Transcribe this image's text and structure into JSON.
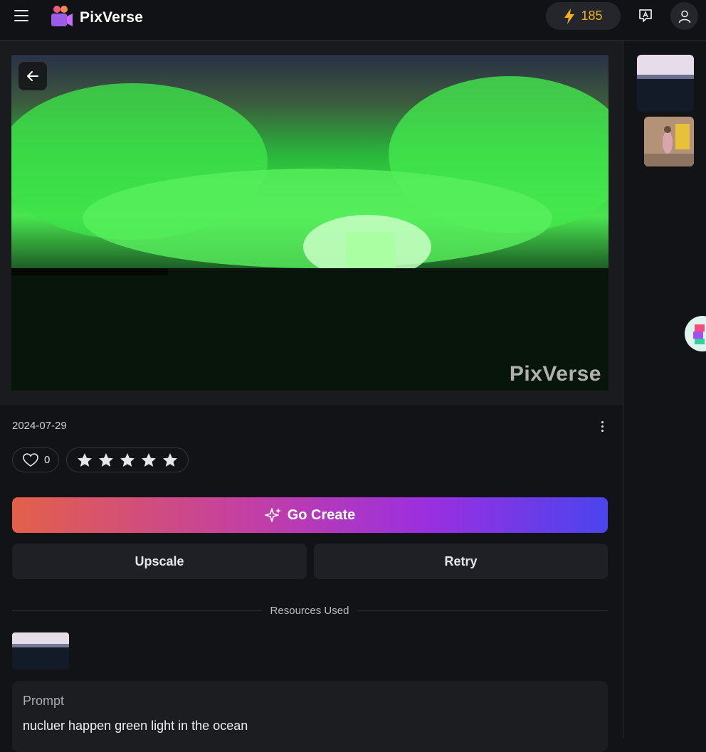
{
  "header": {
    "brand": "PixVerse",
    "credits": "185"
  },
  "video": {
    "watermark": "PixVerse",
    "date": "2024-07-29"
  },
  "reactions": {
    "likes": "0",
    "stars": 5
  },
  "actions": {
    "go_create": "Go Create",
    "upscale": "Upscale",
    "retry": "Retry"
  },
  "resources": {
    "label": "Resources Used"
  },
  "prompt": {
    "title": "Prompt",
    "text": "nucluer happen green light in the ocean"
  },
  "colors": {
    "accent_credits": "#f2b01e",
    "background": "#121316",
    "gradient_start": "#e3604a",
    "gradient_end": "#4b44ee"
  }
}
